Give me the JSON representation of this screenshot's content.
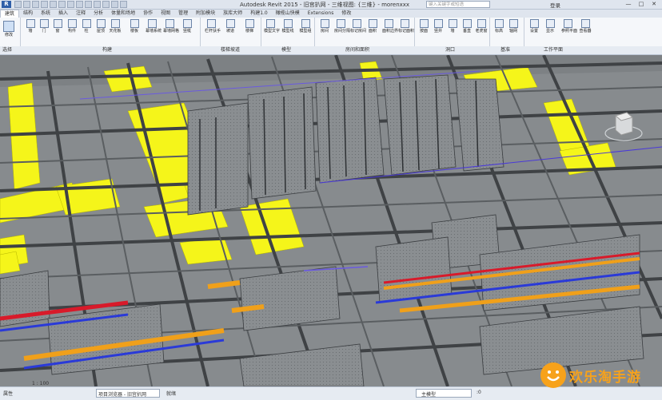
{
  "window": {
    "app_logo": "R",
    "title": "Autodesk Revit 2015 - 旧宫扒网 - 三维视图: {三维} - morenxxx",
    "search_placeholder": "键入关键字或短语",
    "signin": "登录",
    "controls": [
      "—",
      "□",
      "✕"
    ]
  },
  "tabs": [
    {
      "label": "建筑",
      "active": true
    },
    {
      "label": "结构",
      "active": false
    },
    {
      "label": "系统",
      "active": false
    },
    {
      "label": "插入",
      "active": false
    },
    {
      "label": "注释",
      "active": false
    },
    {
      "label": "分析",
      "active": false
    },
    {
      "label": "体量和场地",
      "active": false
    },
    {
      "label": "协作",
      "active": false
    },
    {
      "label": "视图",
      "active": false
    },
    {
      "label": "管理",
      "active": false
    },
    {
      "label": "附加模块",
      "active": false
    },
    {
      "label": "族库大师",
      "active": false
    },
    {
      "label": "构建1.0",
      "active": false
    },
    {
      "label": "橄榄山快模",
      "active": false
    },
    {
      "label": "Extensions",
      "active": false
    },
    {
      "label": "修改",
      "active": false
    }
  ],
  "ribbon": {
    "modify": "修改",
    "buttons": [
      "墙",
      "门",
      "窗",
      "构件",
      "柱",
      "屋顶",
      "天花板",
      "楼板",
      "幕墙系统",
      "幕墙网格",
      "竖梃",
      "栏杆扶手",
      "坡道",
      "楼梯",
      "模型文字",
      "模型线",
      "模型组",
      "房间",
      "房间分隔",
      "标记房间",
      "面积",
      "面积边界",
      "标记面积",
      "按面",
      "竖井",
      "墙",
      "垂直",
      "老虎窗",
      "标高",
      "轴网",
      "设置",
      "显示",
      "参照平面",
      "查看器"
    ],
    "panels": [
      "选择",
      "构建",
      "楼梯坡道",
      "模型",
      "房间和面积",
      "洞口",
      "基准",
      "工作平面"
    ]
  },
  "status": {
    "scale": "1 : 100",
    "browser_tab": "项目浏览器 - 旧宫扒网",
    "properties_tab": "属性",
    "ready": "就绪",
    "model_label": "主模型",
    "selection_count": ":0"
  },
  "watermark": {
    "text": "欢乐淘手游"
  },
  "colors": {
    "viewport_bg": "#6f7478",
    "duct_yellow": "#f5f51a",
    "pipe_red": "#d81a2a",
    "pipe_blue": "#2a3ad8",
    "tray_orange": "#f0a01a",
    "accent": "#2f5fa8"
  }
}
